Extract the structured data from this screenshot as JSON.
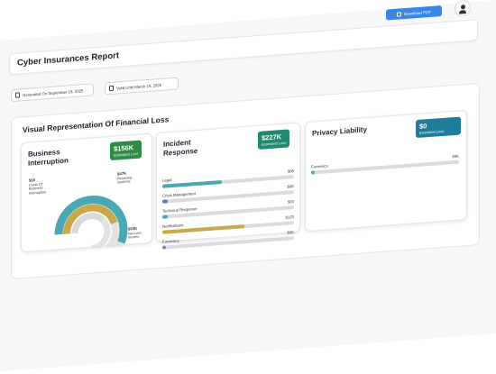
{
  "header": {
    "title": "Cyber Insurances Report",
    "download_label": "Download PDF"
  },
  "meta": {
    "generated": "Generated On September 19, 2025",
    "valid_until": "Valid Until March 19, 2026"
  },
  "section_title": "Visual Representation Of Financial Loss",
  "business_interruption": {
    "title": "Business Interruption",
    "badge_value": "$156K",
    "badge_sub": "Estimated Loss",
    "segments": [
      {
        "label": "Costs Of Business Interruption",
        "value": "$16",
        "fraction": 0.75,
        "color": "#4aa8b5"
      },
      {
        "label": "Restoring Systems",
        "value": "$47K",
        "fraction": 0.6,
        "color": "#c9a84c"
      },
      {
        "label": "Net Loss Income",
        "value": "$93K",
        "fraction": 0.5,
        "color": "#d9d9d9"
      }
    ]
  },
  "incident_response": {
    "title": "Incident Response",
    "badge_value": "$227K",
    "badge_sub": "Estimated Loss",
    "items": [
      {
        "label": "Legal",
        "value": "$85",
        "fraction": 0.45,
        "color": "#4aa8b5"
      },
      {
        "label": "Crisis Management",
        "value": "$6K",
        "fraction": 0.04,
        "color": "#5b7fc4"
      },
      {
        "label": "Technical Response",
        "value": "$93",
        "fraction": 0.04,
        "color": "#4aa8b5"
      },
      {
        "label": "Notifications",
        "value": "$120",
        "fraction": 0.62,
        "color": "#c9a84c"
      },
      {
        "label": "Forensics",
        "value": "$0K",
        "fraction": 0.02,
        "color": "#a66cc4"
      }
    ]
  },
  "privacy_liability": {
    "title": "Privacy Liability",
    "badge_value": "$0",
    "badge_sub": "Estimated Loss",
    "items": [
      {
        "label": "Forensics",
        "value": "$0K",
        "fraction": 0.0,
        "color": "#4aa8b5"
      }
    ]
  }
}
